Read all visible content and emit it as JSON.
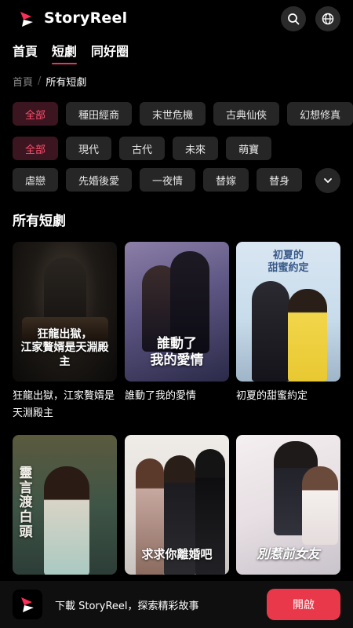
{
  "header": {
    "brand": "StoryReel",
    "search_icon": "search-icon",
    "language_icon": "globe-icon"
  },
  "nav": {
    "tabs": [
      "首頁",
      "短劇",
      "同好圈"
    ],
    "active": "短劇"
  },
  "breadcrumb": {
    "home": "首頁",
    "current": "所有短劇"
  },
  "filters": {
    "row1": [
      "全部",
      "種田經商",
      "末世危機",
      "古典仙俠",
      "幻想修真"
    ],
    "row2": [
      "全部",
      "現代",
      "古代",
      "未來",
      "萌寶"
    ],
    "row3": [
      "虐戀",
      "先婚後愛",
      "一夜情",
      "替嫁",
      "替身"
    ],
    "expand_icon": "chevron-down-icon"
  },
  "section": {
    "title": "所有短劇"
  },
  "dramas": [
    {
      "title": "狂龍出獄，江家贅婿是天淵殿主",
      "poster_text": "狂龍出獄，\n江家贅婿是天淵殿主"
    },
    {
      "title": "誰動了我的愛情",
      "poster_text": "誰動了\n我的愛情"
    },
    {
      "title": "初夏的甜蜜約定",
      "poster_text": "初夏的\n甜蜜約定"
    },
    {
      "title": "",
      "poster_text": "靈言渡白頭"
    },
    {
      "title": "",
      "poster_text": "求求你離婚吧"
    },
    {
      "title": "",
      "poster_text": "別惹前女友"
    }
  ],
  "promo": {
    "text": "下載 StoryReel，探索精彩故事",
    "button": "開啟"
  },
  "colors": {
    "accent": "#e8385a",
    "chip_active_bg": "#3b1620",
    "chip_active_text": "#ff4d6d",
    "chip_bg": "#262626"
  }
}
